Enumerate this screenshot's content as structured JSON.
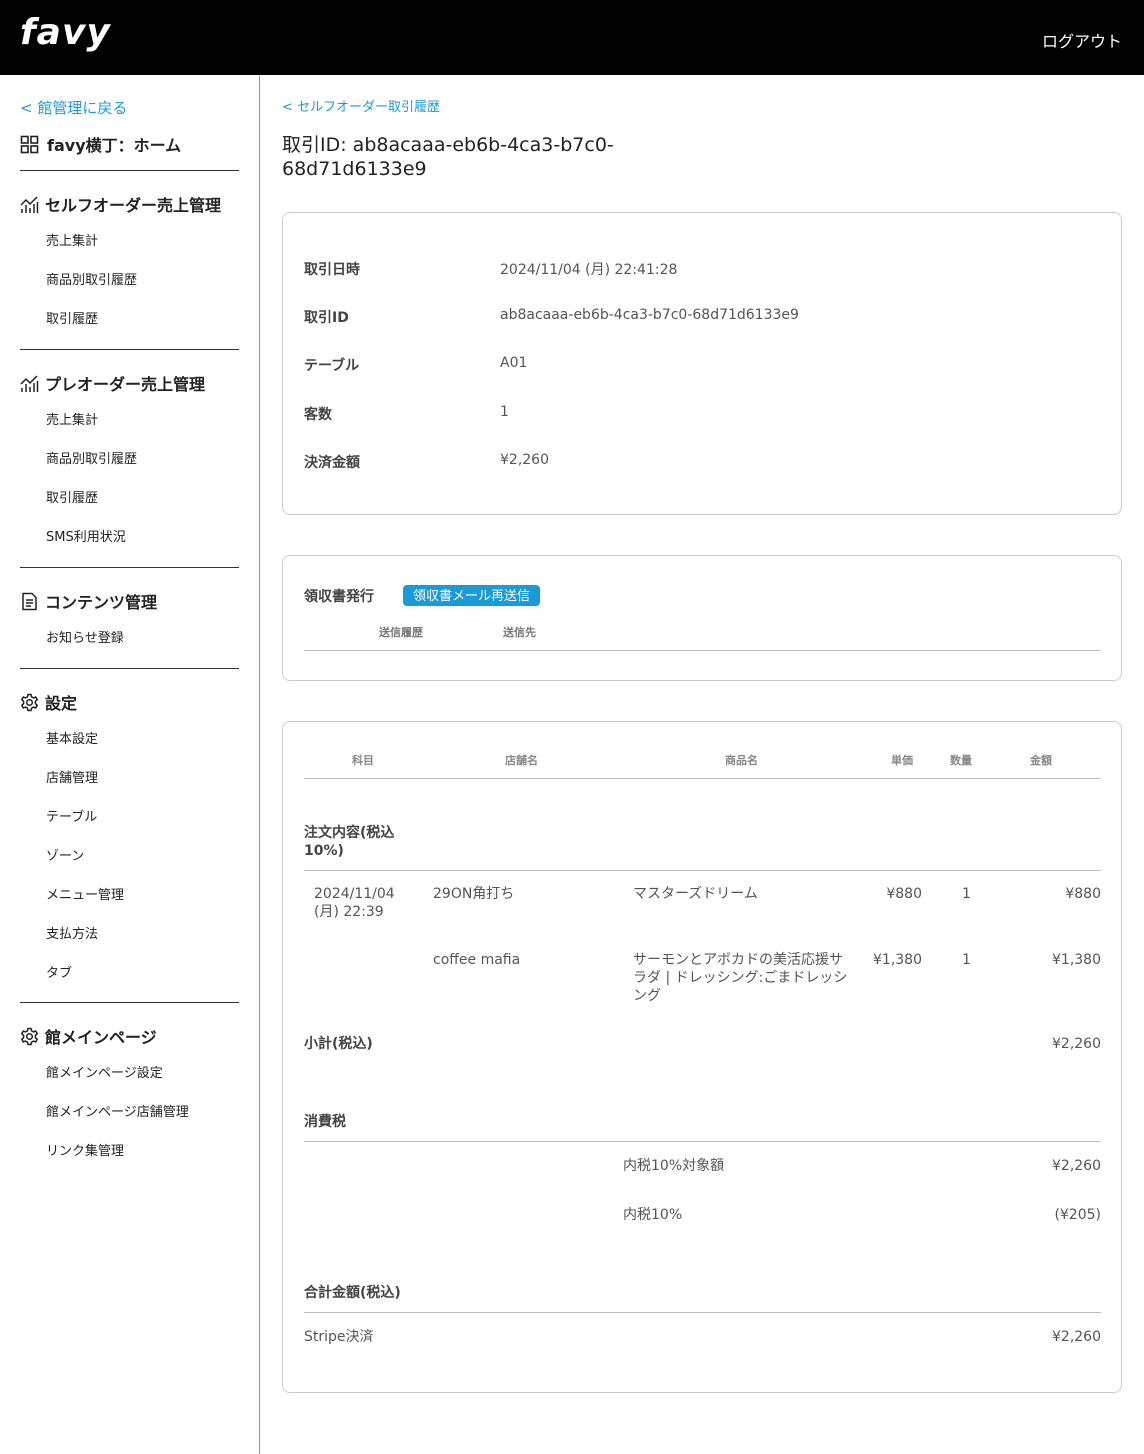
{
  "header": {
    "logo": "favy",
    "logout": "ログアウト"
  },
  "sidebar": {
    "back": "< 館管理に戻る",
    "home": "favy横丁：ホーム",
    "sections": [
      {
        "title": "セルフオーダー売上管理",
        "items": [
          "売上集計",
          "商品別取引履歴",
          "取引履歴"
        ]
      },
      {
        "title": "プレオーダー売上管理",
        "items": [
          "売上集計",
          "商品別取引履歴",
          "取引履歴",
          "SMS利用状況"
        ]
      },
      {
        "title": "コンテンツ管理",
        "items": [
          "お知らせ登録"
        ]
      },
      {
        "title": "設定",
        "items": [
          "基本設定",
          "店舗管理",
          "テーブル",
          "ゾーン",
          "メニュー管理",
          "支払方法",
          "タブ"
        ]
      },
      {
        "title": "館メインページ",
        "items": [
          "館メインページ設定",
          "館メインページ店舗管理",
          "リンク集管理"
        ]
      }
    ]
  },
  "main": {
    "breadcrumb": "< セルフオーダー取引履歴",
    "title": "取引ID: ab8acaaa-eb6b-4ca3-b7c0-68d71d6133e9",
    "info": [
      {
        "label": "取引日時",
        "value": "2024/11/04 (月) 22:41:28"
      },
      {
        "label": "取引ID",
        "value": "ab8acaaa-eb6b-4ca3-b7c0-68d71d6133e9"
      },
      {
        "label": "テーブル",
        "value": "A01"
      },
      {
        "label": "客数",
        "value": "1"
      },
      {
        "label": "決済金額",
        "value": "¥2,260"
      }
    ],
    "receipt": {
      "label": "領収書発行",
      "button": "領収書メール再送信",
      "col_history": "送信履歴",
      "col_to": "送信先"
    },
    "detail": {
      "headers": [
        "科目",
        "店舗名",
        "商品名",
        "単価",
        "数量",
        "金額"
      ],
      "order_section": "注文内容(税込10%)",
      "rows": [
        {
          "date": "2024/11/04 (月) 22:39",
          "store": "29ON角打ち",
          "item": "マスターズドリーム",
          "price": "¥880",
          "qty": "1",
          "amount": "¥880"
        },
        {
          "date": "",
          "store": "coffee mafia",
          "item": "サーモンとアボカドの美活応援サラダ | ドレッシング:ごまドレッシング",
          "price": "¥1,380",
          "qty": "1",
          "amount": "¥1,380"
        }
      ],
      "subtotal_label": "小計(税込)",
      "subtotal": "¥2,260",
      "tax_section": "消費税",
      "tax_rows": [
        {
          "label": "内税10%対象額",
          "value": "¥2,260"
        },
        {
          "label": "内税10%",
          "value": "(¥205)"
        }
      ],
      "total_section": "合計金額(税込)",
      "payment_label": "Stripe決済",
      "payment_value": "¥2,260"
    }
  },
  "colors": {
    "accent": "#1a9bd7",
    "header_bg": "#000000"
  }
}
